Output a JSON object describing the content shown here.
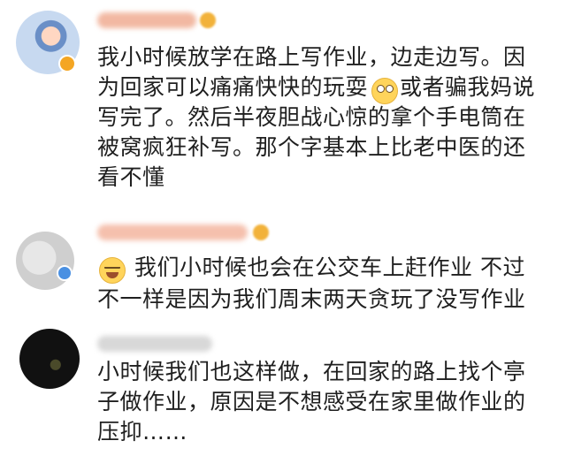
{
  "comments": [
    {
      "lines": [
        "我小时候放学在路上写作业，边走边写。因",
        "为回家可以痛痛快快的玩耍",
        "或者骗我妈说",
        "写完了。然后半夜胆战心惊的拿个手电筒在",
        "被窝疯狂补写。那个字基本上比老中医的还",
        "看不懂"
      ],
      "emoji": "eye-roll-emoji"
    },
    {
      "lines": [
        "我们小时候也会在公交车上赶作业 不过",
        "不一样是因为我们周末两天贪玩了没写作业"
      ],
      "emoji": "crying-laughing-emoji"
    },
    {
      "lines": [
        "小时候我们也这样做，在回家的路上找个亭",
        "子做作业，原因是不想感受在家里做作业的",
        "压抑……"
      ]
    }
  ]
}
